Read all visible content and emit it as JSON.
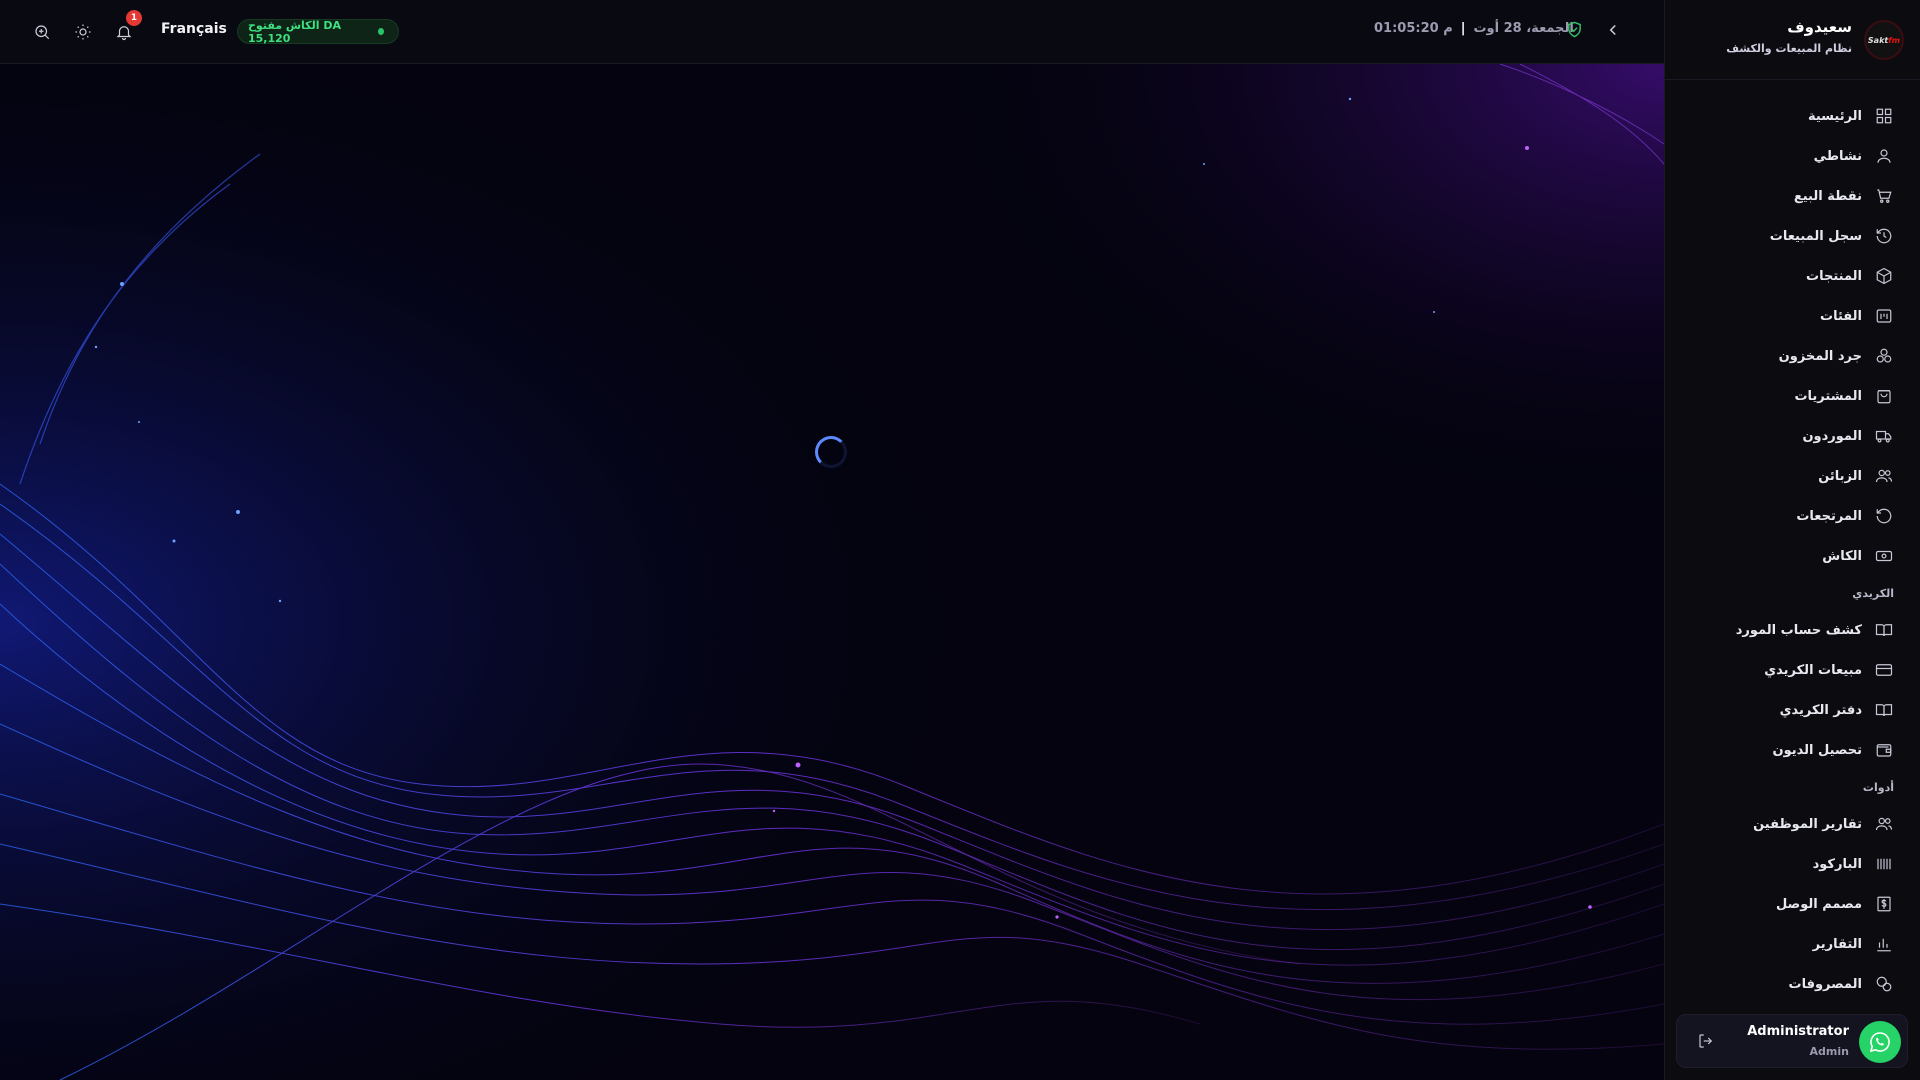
{
  "brand": {
    "name": "سعيدوف",
    "subtitle": "نظام المبيعات والكشف",
    "logo_text_1": "Sakt",
    "logo_text_2": "fm"
  },
  "topbar": {
    "language": "Français",
    "cash_status": "الكاش مفتوح  DA 15,120",
    "date": "الجمعة، 28 أوت",
    "separator": "|",
    "time": "01:05:20 م",
    "notifications_count": "1"
  },
  "sidebar": {
    "items": [
      {
        "label": "الرئيسية",
        "icon": "grid-icon"
      },
      {
        "label": "نشاطي",
        "icon": "user-icon"
      },
      {
        "label": "نقطة البيع",
        "icon": "cart-icon"
      },
      {
        "label": "سجل المبيعات",
        "icon": "history-icon"
      },
      {
        "label": "المنتجات",
        "icon": "box-icon"
      },
      {
        "label": "الفئات",
        "icon": "category-icon"
      },
      {
        "label": "جرد المخزون",
        "icon": "inventory-icon"
      },
      {
        "label": "المشتريات",
        "icon": "shopping-bag-icon"
      },
      {
        "label": "الموردون",
        "icon": "truck-icon"
      },
      {
        "label": "الزبائن",
        "icon": "users-icon"
      },
      {
        "label": "المرتجعات",
        "icon": "return-icon"
      },
      {
        "label": "الكاش",
        "icon": "cash-icon"
      }
    ],
    "section_credit": "الكريدي",
    "credit_items": [
      {
        "label": "كشف حساب المورد",
        "icon": "book-open-icon"
      },
      {
        "label": "مبيعات الكريدي",
        "icon": "credit-card-icon"
      },
      {
        "label": "دفتر الكريدي",
        "icon": "book-icon"
      },
      {
        "label": "تحصيل الديون",
        "icon": "wallet-icon"
      }
    ],
    "section_tools": "أدوات",
    "tool_items": [
      {
        "label": "تقارير الموظفين",
        "icon": "staff-icon"
      },
      {
        "label": "الباركود",
        "icon": "barcode-icon"
      },
      {
        "label": "مصمم الوصل",
        "icon": "receipt-icon"
      },
      {
        "label": "التقارير",
        "icon": "bar-chart-icon"
      },
      {
        "label": "المصروفات",
        "icon": "expenses-icon"
      }
    ]
  },
  "user": {
    "name": "Administrator",
    "role": "Admin"
  },
  "colors": {
    "accent_green": "#3ee07f",
    "whatsapp": "#25d366",
    "badge_red": "#e53935",
    "spinner": "#5d8bff"
  }
}
